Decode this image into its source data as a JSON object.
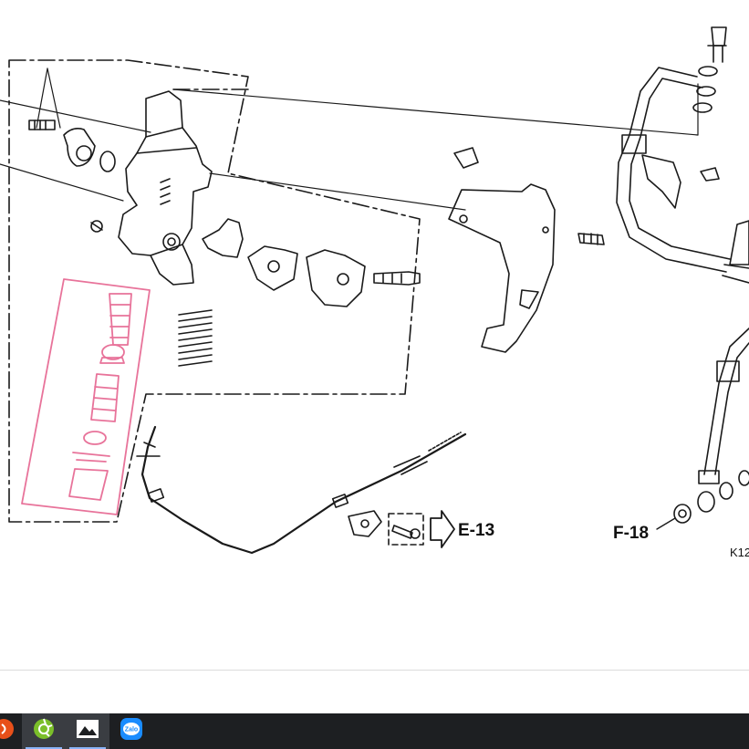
{
  "diagram": {
    "labels": {
      "e13": "E-13",
      "f18": "F-18",
      "part_code": "K12"
    },
    "highlight_color": "#e8739a",
    "line_color": "#1a1a1a"
  },
  "taskbar": {
    "background": "#1d1f22",
    "apps": [
      {
        "icon": "orange-app-icon"
      },
      {
        "icon": "green-app-icon"
      },
      {
        "icon": "photos-app-icon"
      },
      {
        "icon": "zalo-app-icon",
        "text": "Zalo"
      }
    ]
  }
}
